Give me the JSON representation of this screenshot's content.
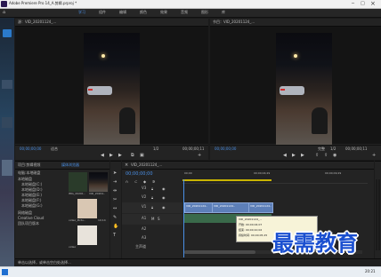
{
  "app": {
    "title": "Adobe Premiere Pro 14_A.剪辑.prproj *",
    "menu": [],
    "workspaces": [
      "学习",
      "组件",
      "编辑",
      "颜色",
      "效果",
      "音频",
      "图形",
      "库"
    ]
  },
  "source_monitor": {
    "header": "源：VID_20201124_...",
    "timecode": "00;00;00;00",
    "fit": "适合",
    "fraction": "1/2",
    "duration": "00;00;00;11"
  },
  "program_monitor": {
    "header": "节目：VID_20201124_...",
    "timecode": "00;00;00;00",
    "fit": "完整",
    "fraction": "1/2",
    "duration": "00;00;00;11"
  },
  "project": {
    "tabs": [
      "项目:剪辑视频",
      "媒体浏览器"
    ],
    "path": "电脑:本地磁盘",
    "tree": [
      "本地磁盘",
      "本地磁盘(C:)",
      "本地磁盘(D:)",
      "本地磁盘(E:)",
      "本地磁盘(F:)",
      "本地磁盘(G:)",
      "网络磁盘",
      "Creative Cloud",
      "团队项目版本"
    ],
    "items": [
      {
        "name": "IMG_20201..",
        "dur": "5;00"
      },
      {
        "name": "VID_20201..",
        "dur": "11;00"
      },
      {
        "name": "video_Pictu..",
        "dur": "10;14"
      },
      {
        "name": "video",
        "dur": "10"
      }
    ]
  },
  "timeline": {
    "tab": "VID_20201124_...",
    "timecode": "00;00;00;00",
    "ruler": [
      "00;00",
      "00;00;04;29",
      "00;00;09;29"
    ],
    "tracks": [
      "V3",
      "V2",
      "V1",
      "A1",
      "A2",
      "A3",
      "主声道"
    ],
    "clips": [
      "VID_20201124..",
      "VID_20201124..",
      "VID_20201124.."
    ],
    "tooltip": {
      "name": "VID_20201124_...",
      "start": "开始: 00;00;04;07",
      "end": "结束: 00;00;10;02",
      "dur": "持续时间: 00;00;05;25"
    }
  },
  "status": "单击以选择，或单击空白处选择...",
  "watermark": "最需教育",
  "desktop": {
    "tray": "20:21"
  }
}
